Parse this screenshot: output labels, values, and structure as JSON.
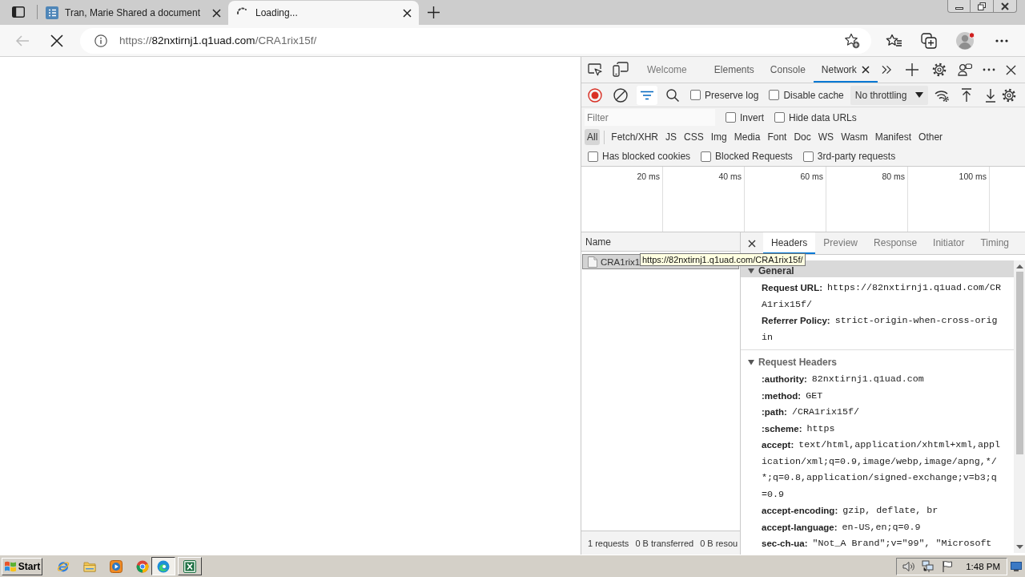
{
  "browser": {
    "tabs": [
      {
        "title": "Tran, Marie Shared a document",
        "selected": false,
        "loading": false
      },
      {
        "title": "Loading...",
        "selected": true,
        "loading": true
      }
    ],
    "back_enabled": false,
    "address": {
      "scheme": "https://",
      "host": "82nxtirnj1.q1uad.com",
      "path": "/CRA1rix15f/"
    }
  },
  "devtools": {
    "tabs": [
      {
        "label": "Welcome",
        "selected": false
      },
      {
        "label": "Elements",
        "selected": false
      },
      {
        "label": "Console",
        "selected": false
      },
      {
        "label": "Network",
        "selected": true
      }
    ],
    "recording": true,
    "filter_shown": true,
    "options": [
      {
        "label": "Preserve log",
        "checked": false
      },
      {
        "label": "Disable cache",
        "checked": false
      }
    ],
    "throttling": "No throttling",
    "filter": {
      "placeholder": "Filter",
      "options": [
        {
          "label": "Invert",
          "checked": false
        },
        {
          "label": "Hide data URLs",
          "checked": false
        }
      ]
    },
    "types": [
      {
        "label": "All",
        "selected": true
      },
      {
        "label": "Fetch/XHR",
        "selected": false
      },
      {
        "label": "JS",
        "selected": false
      },
      {
        "label": "CSS",
        "selected": false
      },
      {
        "label": "Img",
        "selected": false
      },
      {
        "label": "Media",
        "selected": false
      },
      {
        "label": "Font",
        "selected": false
      },
      {
        "label": "Doc",
        "selected": false
      },
      {
        "label": "WS",
        "selected": false
      },
      {
        "label": "Wasm",
        "selected": false
      },
      {
        "label": "Manifest",
        "selected": false
      },
      {
        "label": "Other",
        "selected": false
      }
    ],
    "extra_options": [
      {
        "label": "Has blocked cookies",
        "checked": false
      },
      {
        "label": "Blocked Requests",
        "checked": false
      },
      {
        "label": "3rd-party requests",
        "checked": false
      }
    ],
    "timeline": {
      "ticks": [
        "20 ms",
        "40 ms",
        "60 ms",
        "80 ms",
        "100 ms"
      ]
    },
    "requests": {
      "column": "Name",
      "rows": [
        {
          "name": "CRA1rix1",
          "selected": true
        }
      ],
      "tooltip": "https://82nxtirnj1.q1uad.com/CRA1rix15f/",
      "summary": [
        "1 requests",
        "0 B transferred",
        "0 B resou"
      ]
    },
    "details": {
      "tabs": [
        {
          "label": "Headers",
          "selected": true
        },
        {
          "label": "Preview",
          "selected": false
        },
        {
          "label": "Response",
          "selected": false
        },
        {
          "label": "Initiator",
          "selected": false
        },
        {
          "label": "Timing",
          "selected": false
        }
      ],
      "sections": [
        {
          "title": "General",
          "selected": true,
          "expanded": true,
          "rows": [
            {
              "name": "Request URL:",
              "value": "https://82nxtirnj1.q1uad.com/CRA1rix15f/"
            },
            {
              "name": "Referrer Policy:",
              "value": "strict-origin-when-cross-origin"
            }
          ]
        },
        {
          "title": "Request Headers",
          "selected": false,
          "expanded": true,
          "rows": [
            {
              "name": ":authority:",
              "value": "82nxtirnj1.q1uad.com"
            },
            {
              "name": ":method:",
              "value": "GET"
            },
            {
              "name": ":path:",
              "value": "/CRA1rix15f/"
            },
            {
              "name": ":scheme:",
              "value": "https"
            },
            {
              "name": "accept:",
              "value": "text/html,application/xhtml+xml,application/xml;q=0.9,image/webp,image/apng,*/*;q=0.8,application/signed-exchange;v=b3;q=0.9"
            },
            {
              "name": "accept-encoding:",
              "value": "gzip, deflate, br"
            },
            {
              "name": "accept-language:",
              "value": "en-US,en;q=0.9"
            },
            {
              "name": "sec-ch-ua:",
              "value": "\"Not_A Brand\";v=\"99\", \"Microsoft"
            }
          ]
        }
      ]
    }
  },
  "taskbar": {
    "start": "Start",
    "apps": [
      {
        "selected": true
      },
      {
        "selected": false
      }
    ],
    "clock": "1:48 PM"
  }
}
